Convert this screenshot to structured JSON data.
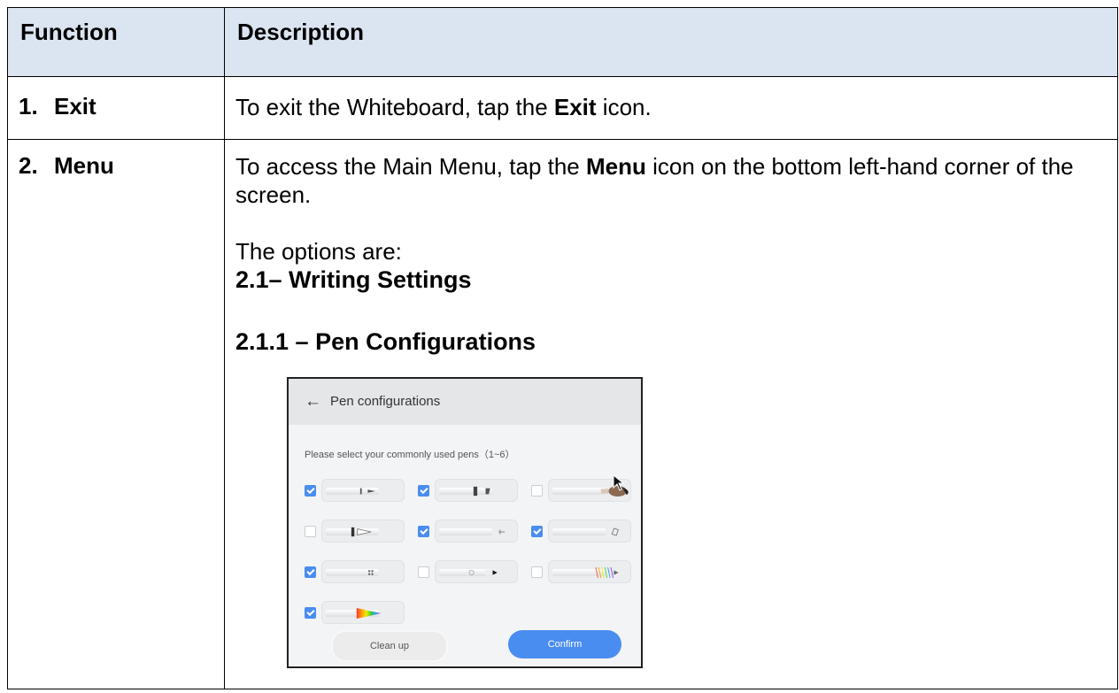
{
  "table": {
    "headers": [
      "Function",
      "Description"
    ],
    "rows": [
      {
        "num": "1.",
        "name": "Exit",
        "desc_pre": "To exit the Whiteboard, tap the ",
        "desc_bold": "Exit",
        "desc_post": " icon."
      },
      {
        "num": "2.",
        "name": "Menu",
        "desc_pre": "To access the Main Menu, tap the ",
        "desc_bold": "Menu",
        "desc_post": " icon on the bottom left-hand corner of the screen.",
        "options_intro": "The options are:",
        "section_1": "2.1– Writing Settings",
        "section_2": "2.1.1 – Pen Configurations"
      }
    ]
  },
  "pen_panel": {
    "title": "Pen configurations",
    "hint": "Please select your commonly used pens（1~6）",
    "pens": [
      {
        "icon": "marker-pen-icon",
        "checked": true
      },
      {
        "icon": "highlighter-pen-icon",
        "checked": true
      },
      {
        "icon": "brush-pen-icon",
        "checked": false
      },
      {
        "icon": "fountain-pen-icon",
        "checked": false
      },
      {
        "icon": "fine-pen-icon",
        "checked": true
      },
      {
        "icon": "eraser-pen-icon",
        "checked": true
      },
      {
        "icon": "dotted-pen-icon",
        "checked": true
      },
      {
        "icon": "ink-pen-icon",
        "checked": false
      },
      {
        "icon": "rainbow-brush-icon",
        "checked": false
      },
      {
        "icon": "rainbow-pen-icon",
        "checked": true
      }
    ],
    "clean_label": "Clean up",
    "confirm_label": "Confirm",
    "accent_color": "#4a8df0"
  }
}
